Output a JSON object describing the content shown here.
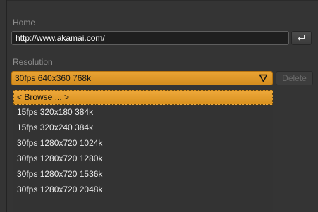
{
  "home": {
    "label": "Home",
    "url_value": "http://www.akamai.com/",
    "go_icon": "return-arrow-icon"
  },
  "resolution": {
    "label": "Resolution",
    "selected": "30fps 640x360 768k",
    "delete_label": "Delete",
    "accent": "#e29a2b"
  },
  "dropdown": {
    "items": [
      {
        "label": "< Browse ... >",
        "selected": true
      },
      {
        "label": "15fps 320x180 384k",
        "selected": false
      },
      {
        "label": "15fps 320x240 384k",
        "selected": false
      },
      {
        "label": "30fps 1280x720 1024k",
        "selected": false
      },
      {
        "label": "30fps 1280x720 1280k",
        "selected": false
      },
      {
        "label": "30fps 1280x720 1536k",
        "selected": false
      },
      {
        "label": "30fps 1280x720 2048k",
        "selected": false
      }
    ]
  }
}
